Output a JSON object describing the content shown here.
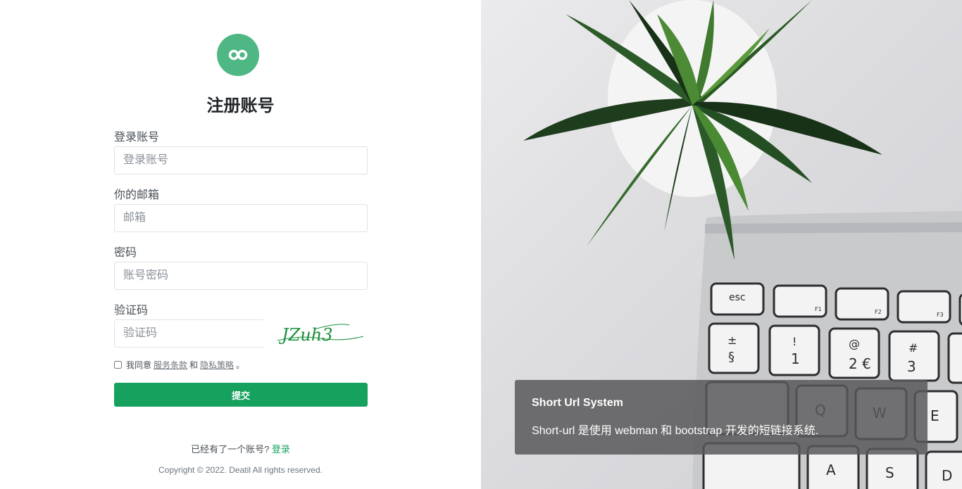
{
  "form": {
    "title": "注册账号",
    "username": {
      "label": "登录账号",
      "placeholder": "登录账号"
    },
    "email": {
      "label": "你的邮箱",
      "placeholder": "邮箱"
    },
    "password": {
      "label": "密码",
      "placeholder": "账号密码"
    },
    "captcha": {
      "label": "验证码",
      "placeholder": "验证码",
      "image_text": "JZuh3"
    },
    "agree": {
      "prefix": "我同意",
      "terms_link": "服务条款",
      "and": "和",
      "privacy_link": "隐私策略",
      "suffix": "。"
    },
    "submit_label": "提交"
  },
  "footer": {
    "prompt": "已经有了一个账号?",
    "login_link": "登录",
    "copyright": "Copyright © 2022. Deatil All rights reserved."
  },
  "hero": {
    "card_title": "Short Url System",
    "card_description": "Short-url 是使用 webman 和 bootstrap 开发的短链接系统.",
    "keys": [
      "esc",
      "F1",
      "F2",
      "F3",
      "±",
      "§",
      "!",
      "1",
      "@",
      "2 €",
      "#",
      "3",
      "Q",
      "W",
      "E",
      "A",
      "S",
      "D"
    ]
  },
  "colors": {
    "logo_bg": "#4fb783",
    "submit_bg": "#17a15f",
    "link_green": "#17a15f",
    "captcha_text": "#1a8f3a"
  },
  "icons": {
    "logo": "infinity-icon",
    "captcha": "captcha-image"
  }
}
